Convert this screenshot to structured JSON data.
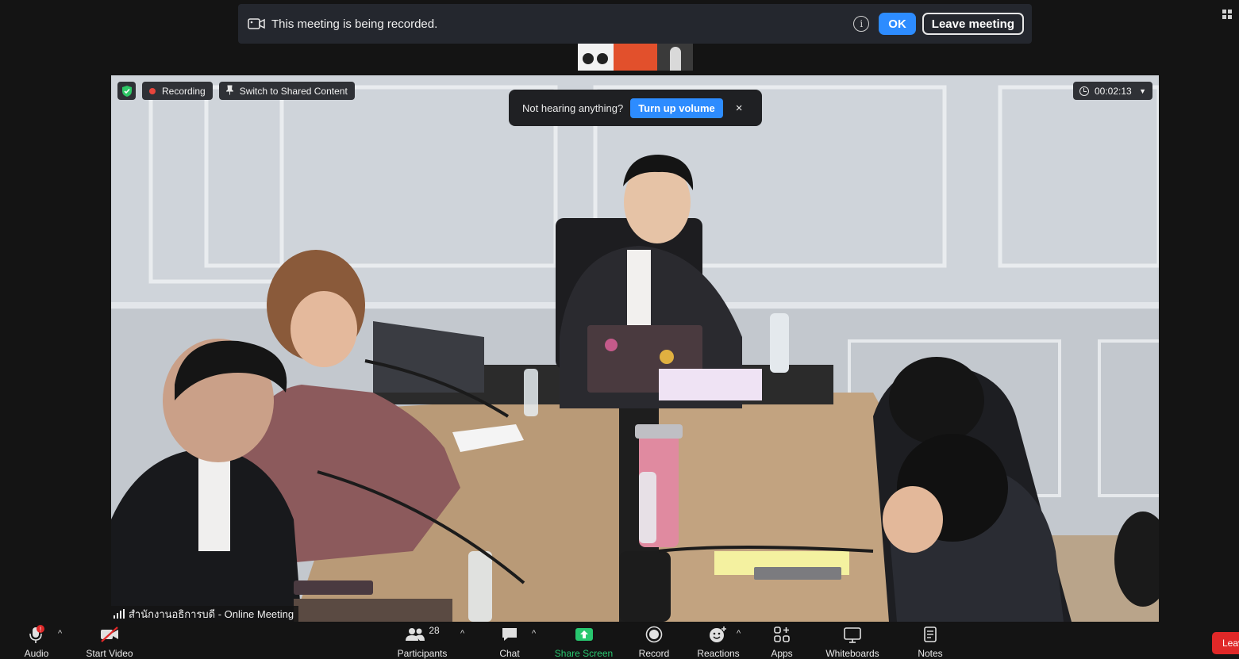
{
  "banner": {
    "message": "This meeting is being recorded.",
    "ok_label": "OK",
    "leave_label": "Leave meeting"
  },
  "video_overlay": {
    "recording_label": "Recording",
    "switch_label": "Switch to Shared Content",
    "hearing_prompt": "Not hearing anything?",
    "volume_button": "Turn up volume",
    "close_glyph": "×",
    "timer": "00:02:13",
    "participant_name": "สำนักงานอธิการบดี - Online Meeting"
  },
  "toolbar": {
    "audio": "Audio",
    "start_video": "Start Video",
    "participants": "Participants",
    "participants_count": "28",
    "chat": "Chat",
    "share_screen": "Share Screen",
    "record": "Record",
    "reactions": "Reactions",
    "apps": "Apps",
    "whiteboards": "Whiteboards",
    "notes": "Notes",
    "leave": "Leave"
  },
  "colors": {
    "accent": "#2d8cff",
    "recording": "#e8453c",
    "share_green": "#28c76f",
    "leave_red": "#e02828"
  }
}
